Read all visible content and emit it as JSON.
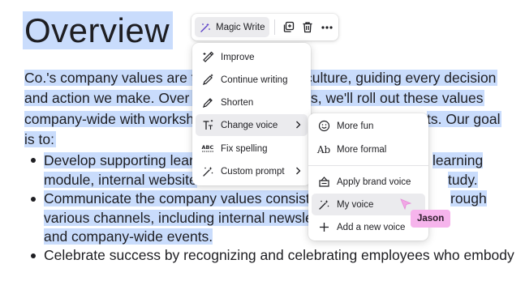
{
  "document": {
    "title": "Overview",
    "paragraph_lines": [
      "Co.'s company values are th",
      "culture, guiding every decision",
      "and action we make. Over th",
      "s, we'll roll out these values",
      "company-wide with workshe",
      "ts. Our goal",
      "is to:"
    ],
    "bullets": [
      {
        "lines": [
          "Develop supporting lear",
          "learning",
          "module, internal website",
          "tudy."
        ]
      },
      {
        "lines": [
          "Communicate the company values consiste",
          "rough",
          "various channels, including internal newslet",
          "and company-wide events."
        ]
      },
      {
        "lines": [
          "Celebrate success by recognizing and celebrating employees who embody"
        ]
      }
    ]
  },
  "toolbar": {
    "magic_write_label": "Magic Write",
    "icons": [
      "magic-wand-icon",
      "duplicate-icon",
      "trash-icon",
      "more-icon"
    ]
  },
  "menu": {
    "items": [
      {
        "label": "Improve",
        "icon": "improve-icon"
      },
      {
        "label": "Continue writing",
        "icon": "pencil-sparkle-icon"
      },
      {
        "label": "Shorten",
        "icon": "pencil-icon"
      },
      {
        "label": "Change voice",
        "icon": "text-size-icon",
        "submenu": true,
        "active": true
      },
      {
        "label": "Fix spelling",
        "icon": "abc-icon"
      },
      {
        "label": "Custom prompt",
        "icon": "magic-wand-icon",
        "submenu": true
      }
    ]
  },
  "submenu": {
    "items": [
      {
        "label": "More fun",
        "icon": "smiley-icon"
      },
      {
        "label": "More formal",
        "icon": "ab-text-icon",
        "glyph": "Ab"
      },
      {
        "label": "Apply brand voice",
        "icon": "brand-kit-icon"
      },
      {
        "label": "My voice",
        "icon": "magic-wand-icon",
        "active": true
      },
      {
        "label": "Add a new voice",
        "icon": "plus-icon"
      }
    ]
  },
  "collaborator": {
    "name": "Jason",
    "color": "#f6b4ec"
  },
  "colors": {
    "selection": "#c9dcfc",
    "menu_active": "#ebebee",
    "cursor": "#f2a6e6"
  }
}
